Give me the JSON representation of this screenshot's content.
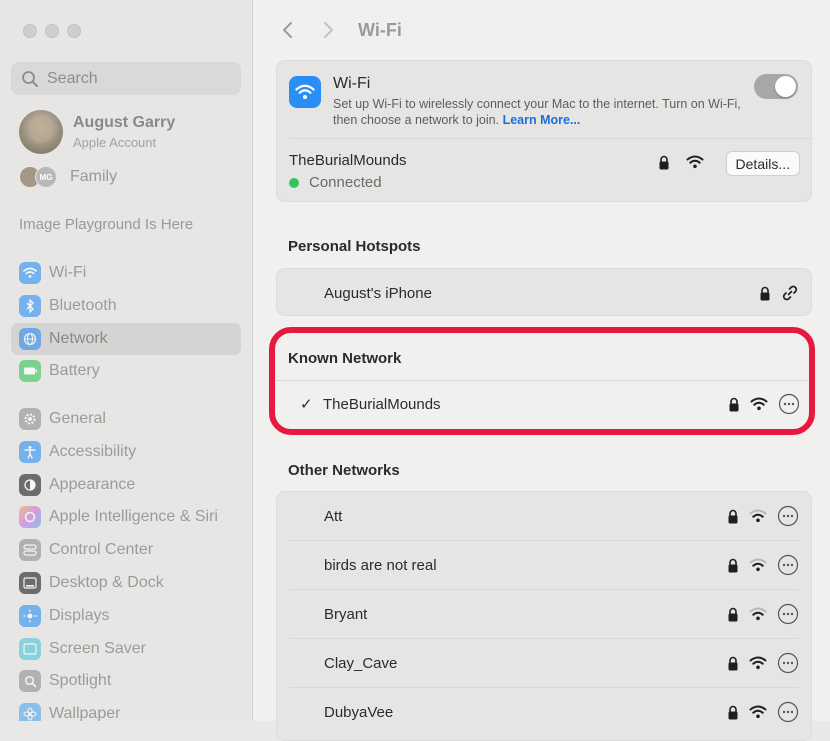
{
  "window": {
    "title": "Wi-Fi"
  },
  "sidebar": {
    "search_placeholder": "Search",
    "account": {
      "name": "August Garry",
      "subtitle": "Apple Account"
    },
    "family": {
      "label": "Family",
      "avatar_initials": "MG"
    },
    "promo": "Image Playground Is Here",
    "items_group1": [
      {
        "label": "Wi-Fi",
        "icon": "wifi-icon",
        "color": "#2b8ef4"
      },
      {
        "label": "Bluetooth",
        "icon": "bluetooth-icon",
        "color": "#2b8ef4"
      },
      {
        "label": "Network",
        "icon": "globe-icon",
        "color": "#2b8ef4",
        "active": true
      },
      {
        "label": "Battery",
        "icon": "battery-icon",
        "color": "#35c45a"
      }
    ],
    "items_group2": [
      {
        "label": "General",
        "icon": "gear-icon",
        "color": "#8e8e93"
      },
      {
        "label": "Accessibility",
        "icon": "accessibility-icon",
        "color": "#2b8ef4"
      },
      {
        "label": "Appearance",
        "icon": "appearance-icon",
        "color": "#1c1c1e"
      },
      {
        "label": "Apple Intelligence & Siri",
        "icon": "siri-icon",
        "color": "#c86be0"
      },
      {
        "label": "Control Center",
        "icon": "control-center-icon",
        "color": "#8e8e93"
      },
      {
        "label": "Desktop & Dock",
        "icon": "dock-icon",
        "color": "#1c1c1e"
      },
      {
        "label": "Displays",
        "icon": "sun-icon",
        "color": "#2b8ef4"
      },
      {
        "label": "Screen Saver",
        "icon": "screensaver-icon",
        "color": "#4fc3d9"
      },
      {
        "label": "Spotlight",
        "icon": "search-icon",
        "color": "#8e8e93"
      },
      {
        "label": "Wallpaper",
        "icon": "flower-icon",
        "color": "#4fa8e8"
      }
    ]
  },
  "main": {
    "wifi_card": {
      "title": "Wi-Fi",
      "description": "Set up Wi-Fi to wirelessly connect your Mac to the internet. Turn on Wi-Fi, then choose a network to join.",
      "learn_more": "Learn More...",
      "toggle_state": "on",
      "current_network": "TheBurialMounds",
      "status": "Connected",
      "details_button": "Details..."
    },
    "personal_hotspots": {
      "heading": "Personal Hotspots",
      "items": [
        {
          "name": "August's iPhone"
        }
      ]
    },
    "known_network": {
      "heading": "Known Network",
      "items": [
        {
          "name": "TheBurialMounds",
          "check": "✓"
        }
      ]
    },
    "other_networks": {
      "heading": "Other Networks",
      "items": [
        {
          "name": "Att"
        },
        {
          "name": "birds are not real"
        },
        {
          "name": "Bryant"
        },
        {
          "name": "Clay_Cave"
        },
        {
          "name": "DubyaVee"
        }
      ]
    }
  }
}
